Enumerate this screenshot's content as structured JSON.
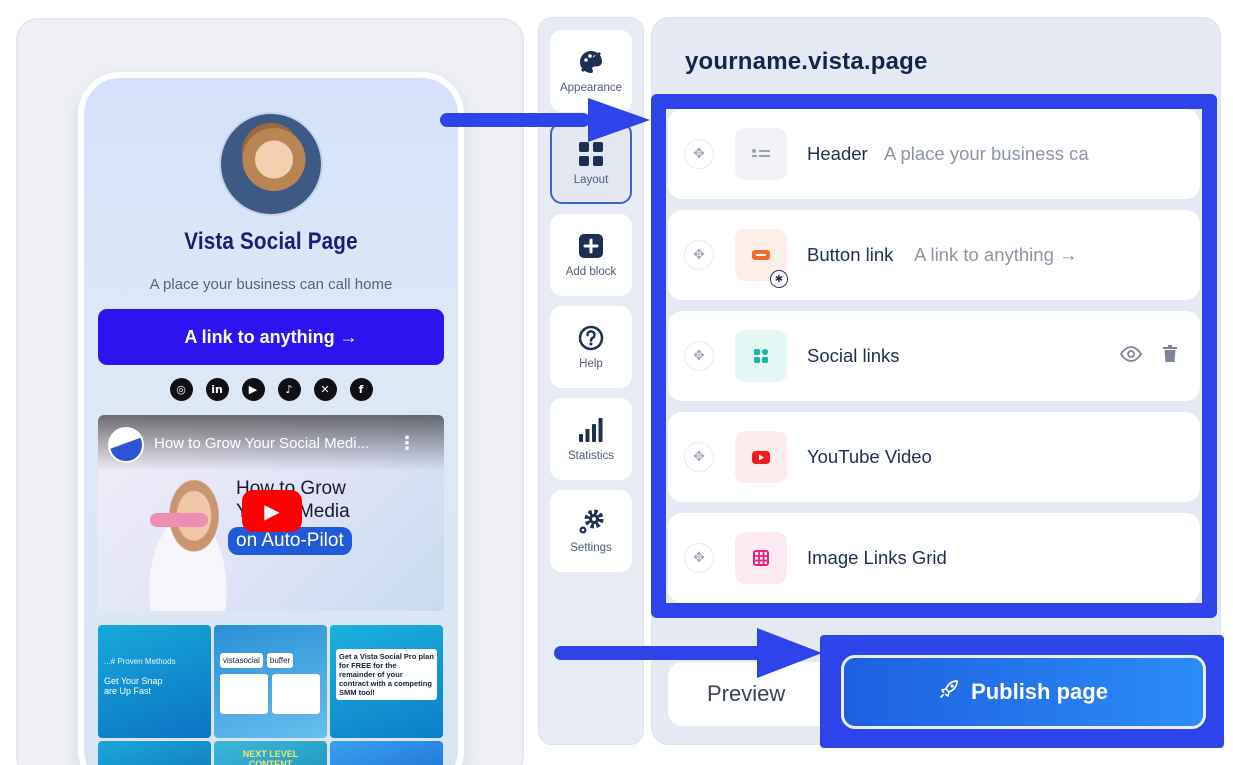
{
  "preview": {
    "page_title": "Vista Social Page",
    "page_subtitle": "A place your business can call home",
    "link_button": "A link to anything →",
    "social_icons": [
      "instagram-icon",
      "linkedin-icon",
      "youtube-icon",
      "tiktok-icon",
      "x-icon",
      "facebook-icon"
    ],
    "video": {
      "title": "How to Grow Your Social Medi...",
      "headline_line1": "How to Grow",
      "headline_line2": "Y   ocial Media",
      "headline_pill": "on Auto-Pilot"
    },
    "grid_tiles": [
      {
        "text": "Get Your Snap",
        "text2": "are Up Fast",
        "tag": "...# Proven Methods"
      },
      {
        "text": "vistasocial",
        "text2": "buffer"
      },
      {
        "text": "Get a Vista Social Pro plan for FREE for the remainder of your contract with a competing SMM tool!"
      },
      {
        "text": ""
      },
      {
        "text": "NEXT LEVEL CONTENT MANAGEMENT"
      },
      {
        "text": ""
      }
    ]
  },
  "nav": {
    "items": [
      {
        "label": "Appearance",
        "icon": "palette-icon"
      },
      {
        "label": "Layout",
        "icon": "grid-icon",
        "active": true
      },
      {
        "label": "Add block",
        "icon": "plus-square-icon"
      },
      {
        "label": "Help",
        "icon": "question-icon"
      },
      {
        "label": "Statistics",
        "icon": "bar-chart-icon"
      },
      {
        "label": "Settings",
        "icon": "gear-icon"
      }
    ]
  },
  "editor": {
    "domain": "yourname.vista.page",
    "blocks": [
      {
        "name": "Header",
        "desc": "A place your business ca",
        "icon": "header-icon",
        "icon_bg": "#f1f2f5"
      },
      {
        "name": "Button link",
        "desc": "A link to anything →",
        "icon": "button-icon",
        "icon_bg": "#fdeee7"
      },
      {
        "name": "Social links",
        "desc": "",
        "icon": "social-grid-icon",
        "icon_bg": "#e3f7f4"
      },
      {
        "name": "YouTube Video",
        "desc": "",
        "icon": "youtube-icon",
        "icon_bg": "#fdecec"
      },
      {
        "name": "Image Links Grid",
        "desc": "",
        "icon": "image-grid-icon",
        "icon_bg": "#fde9f1"
      }
    ],
    "preview_button": "Preview",
    "publish_button": "Publish page"
  },
  "colors": {
    "highlight": "#2f43ea",
    "primary_link": "#2c14f0",
    "publish_gradient_start": "#1e5fe0",
    "publish_gradient_end": "#2b8cf6"
  }
}
